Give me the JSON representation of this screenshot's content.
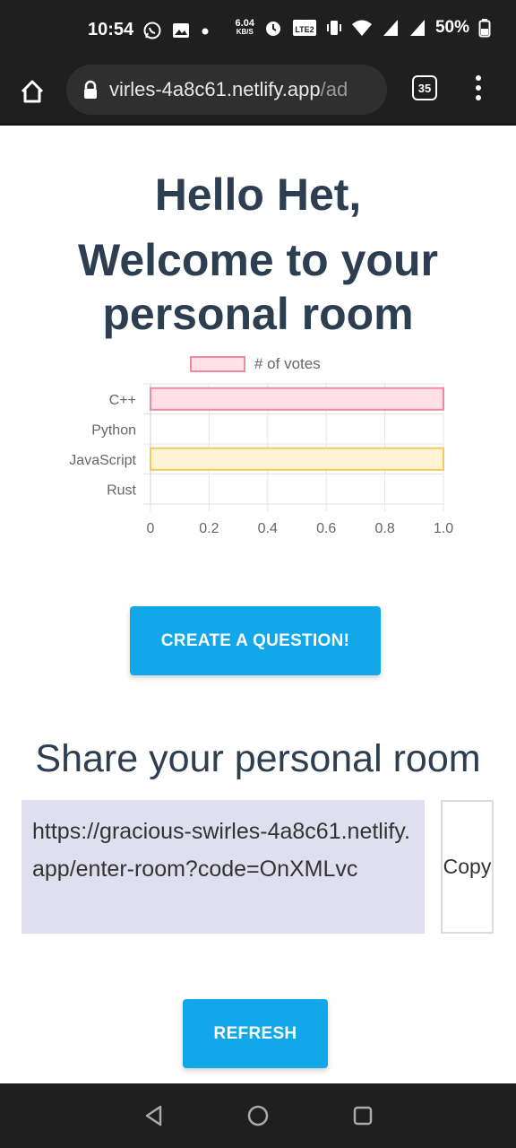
{
  "status": {
    "time": "10:54",
    "speed_value": "6.04",
    "speed_unit": "KB/S",
    "volte": "LTE2",
    "battery": "50%"
  },
  "browser": {
    "url_main": "virles-4a8c61.netlify.app",
    "url_rest": "/ad",
    "tab_count": "35"
  },
  "page": {
    "greeting": "Hello Het,",
    "welcome": "Welcome to your personal room",
    "create_button": "CREATE A QUESTION!",
    "share_heading": "Share your personal room",
    "share_link": "https://gracious-swirles-4a8c61.netlify.app/enter-room?code=OnXMLvc",
    "copy_label": "Copy",
    "refresh_button": "REFRESH"
  },
  "chart_data": {
    "type": "bar",
    "orientation": "horizontal",
    "categories": [
      "C++",
      "Python",
      "JavaScript",
      "Rust"
    ],
    "series": [
      {
        "name": "# of votes",
        "values": [
          1,
          0,
          1,
          0
        ]
      }
    ],
    "bar_colors": [
      "#ffe0e6",
      "#e0ecff",
      "#fff4d6",
      "#e0f5f5"
    ],
    "bar_borders": [
      "#f08aa0",
      "#7fb0f0",
      "#f4c95d",
      "#6fd0cf"
    ],
    "xlim": [
      0,
      1.0
    ],
    "xticks": [
      "0",
      "0.2",
      "0.4",
      "0.6",
      "0.8",
      "1.0"
    ],
    "grid": true,
    "legend": "top"
  }
}
